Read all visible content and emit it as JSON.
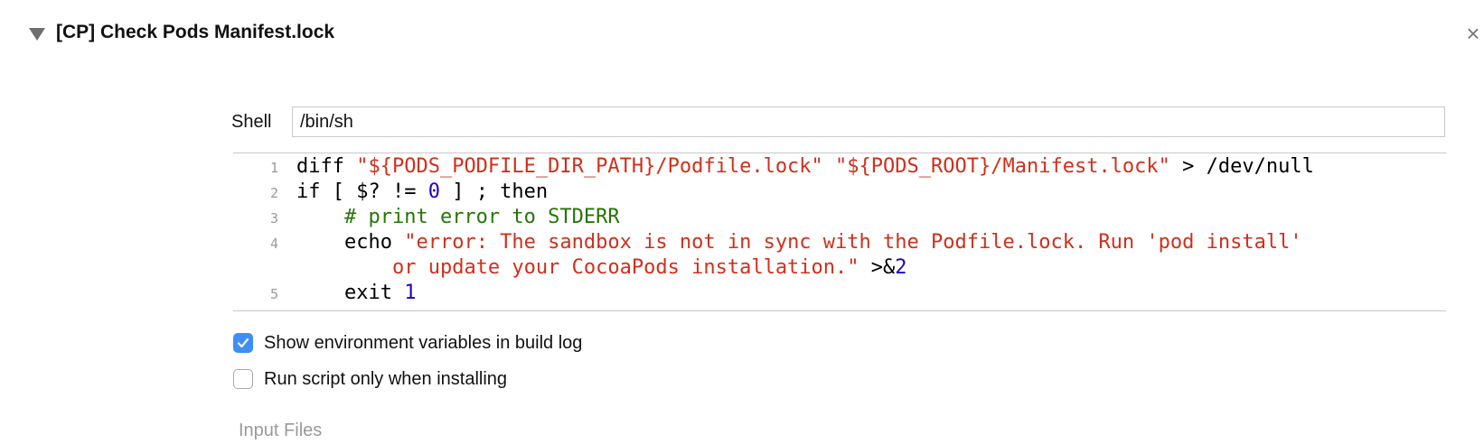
{
  "phase": {
    "title": "[CP] Check Pods Manifest.lock",
    "close_symbol": "×"
  },
  "shell": {
    "label": "Shell",
    "value": "/bin/sh"
  },
  "script": {
    "line_numbers": [
      "1",
      "2",
      "3",
      "4",
      "5"
    ],
    "line1": {
      "kw": "diff ",
      "s1": "\"${PODS_PODFILE_DIR_PATH}/Podfile.lock\"",
      "sp": " ",
      "s2": "\"${PODS_ROOT}/Manifest.lock\"",
      "rest": " > /dev/null"
    },
    "line2": {
      "a": "if [ $? != ",
      "num": "0",
      "b": " ] ; then"
    },
    "line3": {
      "indent": "    ",
      "comment": "# print error to STDERR"
    },
    "line4": {
      "indent": "    ",
      "kw": "echo ",
      "str": "\"error: The sandbox is not in sync with the Podfile.lock. Run 'pod install'"
    },
    "line4b": {
      "indent": "        ",
      "str": "or update your CocoaPods installation.\"",
      "redir": " >&",
      "num": "2"
    },
    "line5": {
      "indent": "    ",
      "kw": "exit ",
      "num": "1"
    }
  },
  "options": {
    "show_env_label": "Show environment variables in build log",
    "show_env_checked": true,
    "install_only_label": "Run script only when installing",
    "install_only_checked": false
  },
  "input_files_label": "Input Files",
  "colors": {
    "string": "#d12f1b",
    "number": "#1c00cf",
    "comment": "#267507",
    "checkbox_accent": "#3d8ef7"
  }
}
